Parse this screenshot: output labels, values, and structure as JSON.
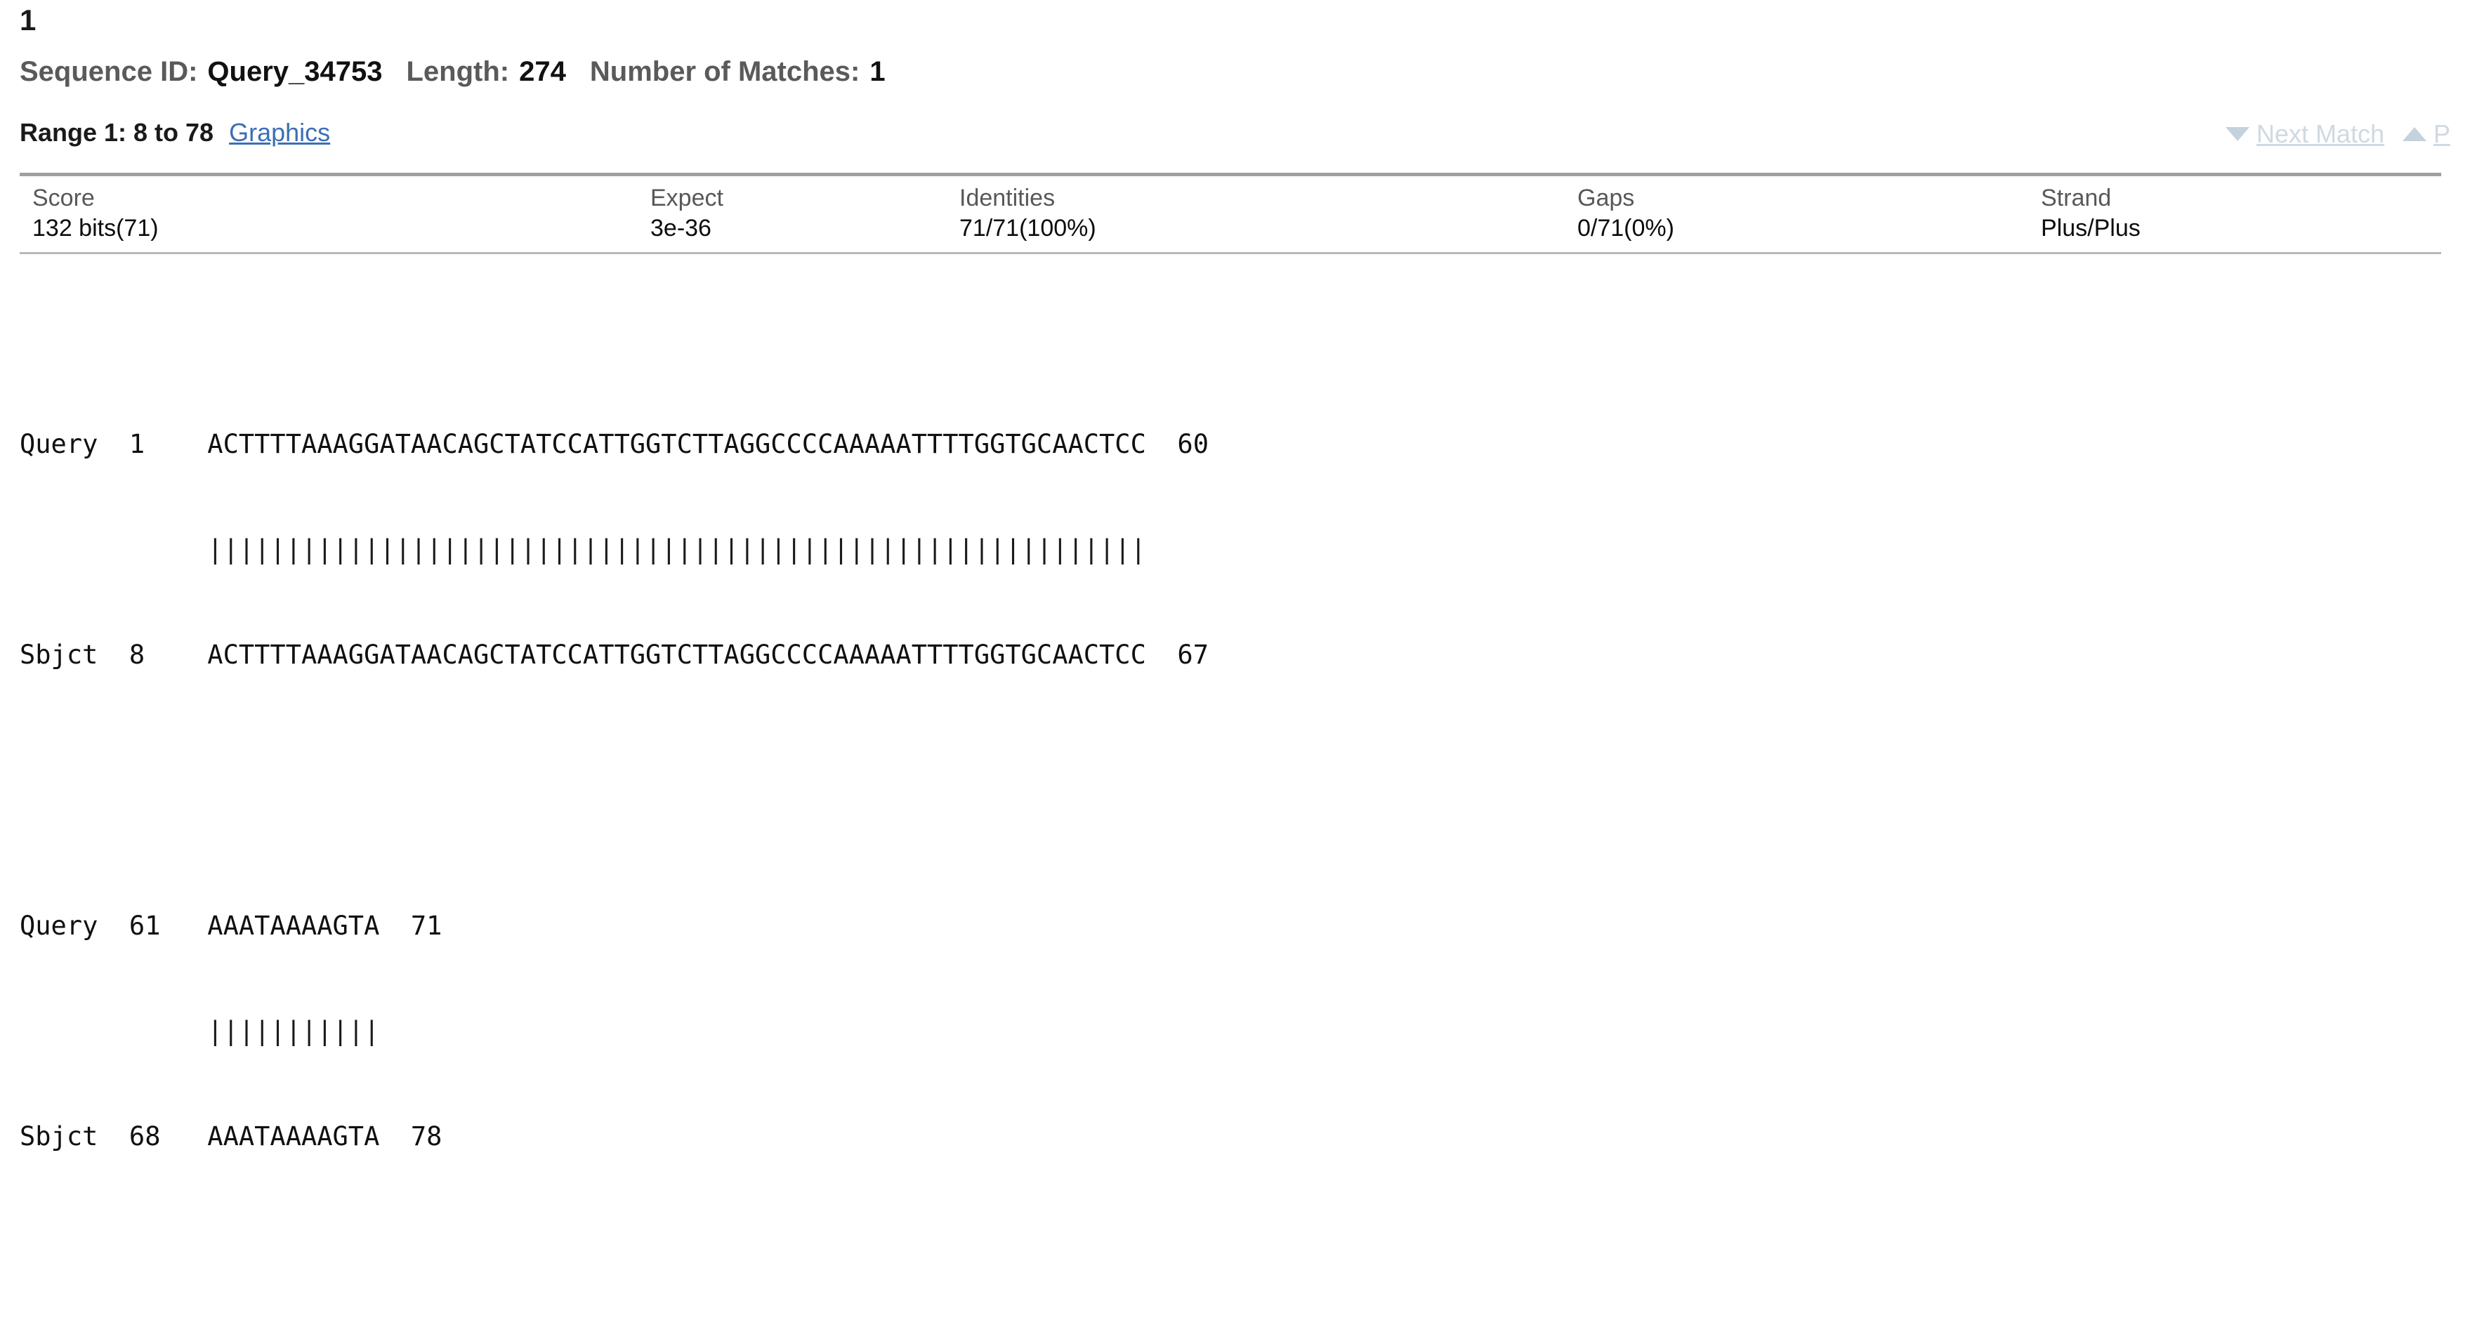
{
  "hit": {
    "number": "1"
  },
  "defline": {
    "sequence_id_label": "Sequence ID:",
    "sequence_id_value": "Query_34753",
    "length_label": "Length:",
    "length_value": "274",
    "matches_label": "Number of Matches:",
    "matches_value": "1"
  },
  "range": {
    "title": "Range 1: 8 to 78",
    "graphics_link": "Graphics",
    "next_match": "Next Match",
    "prev_match": "P",
    "down_icon": "triangle-down-icon",
    "up_icon": "triangle-up-icon"
  },
  "stats": {
    "headers": [
      "Score",
      "Expect",
      "Identities",
      "Gaps",
      "Strand"
    ],
    "values": [
      "132 bits(71)",
      "3e-36",
      "71/71(100%)",
      "0/71(0%)",
      "Plus/Plus"
    ]
  },
  "alignment": {
    "blocks": [
      {
        "query_label": "Query",
        "query_start": "1",
        "query_seq": "ACTTTTAAAGGATAACAGCTATCCATTGGTCTTAGGCCCCAAAAATTTTGGTGCAACTCC",
        "query_end": "60",
        "midline": "||||||||||||||||||||||||||||||||||||||||||||||||||||||||||||",
        "sbjct_label": "Sbjct",
        "sbjct_start": "8",
        "sbjct_seq": "ACTTTTAAAGGATAACAGCTATCCATTGGTCTTAGGCCCCAAAAATTTTGGTGCAACTCC",
        "sbjct_end": "67",
        "line1": "Query  1    ACTTTTAAAGGATAACAGCTATCCATTGGTCTTAGGCCCCAAAAATTTTGGTGCAACTCC  60",
        "line2": "            ||||||||||||||||||||||||||||||||||||||||||||||||||||||||||||",
        "line3": "Sbjct  8    ACTTTTAAAGGATAACAGCTATCCATTGGTCTTAGGCCCCAAAAATTTTGGTGCAACTCC  67"
      },
      {
        "query_label": "Query",
        "query_start": "61",
        "query_seq": "AAATAAAAGTA",
        "query_end": "71",
        "midline": "|||||||||||",
        "sbjct_label": "Sbjct",
        "sbjct_start": "68",
        "sbjct_seq": "AAATAAAAGTA",
        "sbjct_end": "78",
        "line1": "Query  61   AAATAAAAGTA  71",
        "line2": "            |||||||||||",
        "line3": "Sbjct  68   AAATAAAAGTA  78"
      }
    ]
  },
  "colors": {
    "link": "#3b6fb6",
    "label_gray": "#585858",
    "disabled_gray": "#cfd9e2",
    "rule_gray": "#a0a0a0",
    "text": "#101010"
  }
}
